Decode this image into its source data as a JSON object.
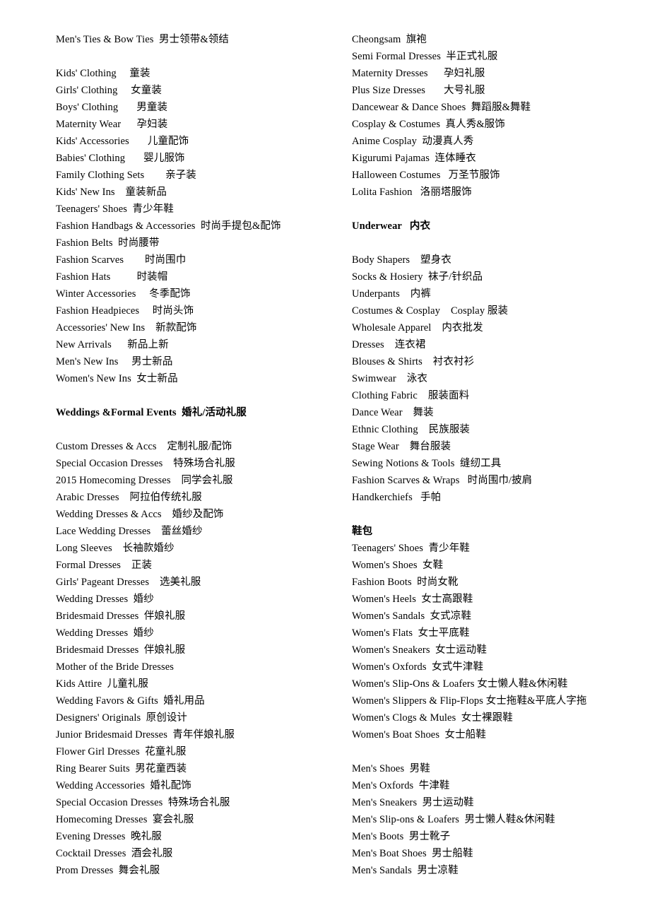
{
  "document": {
    "title": "Clothing & Shoes Category List (English / Chinese)",
    "background_color": "#ffffff",
    "text_color": "#000000",
    "columns": 2
  },
  "left_column": {
    "name": "left-category-column",
    "lines": [
      {
        "type": "entry",
        "text": "Men's Ties & Bow Ties  男士领带&领结"
      },
      {
        "type": "spacer",
        "text": " "
      },
      {
        "type": "entry",
        "text": "Kids' Clothing     童装"
      },
      {
        "type": "entry",
        "text": "Girls' Clothing     女童装"
      },
      {
        "type": "entry",
        "text": "Boys' Clothing       男童装"
      },
      {
        "type": "entry",
        "text": "Maternity Wear      孕妇装"
      },
      {
        "type": "entry",
        "text": "Kids' Accessories       儿童配饰"
      },
      {
        "type": "entry",
        "text": "Babies' Clothing       婴儿服饰"
      },
      {
        "type": "entry",
        "text": "Family Clothing Sets        亲子装"
      },
      {
        "type": "entry",
        "text": "Kids' New Ins    童装新品"
      },
      {
        "type": "entry",
        "text": "Teenagers' Shoes  青少年鞋"
      },
      {
        "type": "entry",
        "text": "Fashion Handbags & Accessories  时尚手提包&配饰"
      },
      {
        "type": "entry",
        "text": "Fashion Belts  时尚腰带"
      },
      {
        "type": "entry",
        "text": "Fashion Scarves        时尚围巾"
      },
      {
        "type": "entry",
        "text": "Fashion Hats          时装帽"
      },
      {
        "type": "entry",
        "text": "Winter Accessories     冬季配饰"
      },
      {
        "type": "entry",
        "text": "Fashion Headpieces     时尚头饰"
      },
      {
        "type": "entry",
        "text": "Accessories' New Ins    新款配饰"
      },
      {
        "type": "entry",
        "text": "New Arrivals      新品上新"
      },
      {
        "type": "entry",
        "text": "Men's New Ins     男士新品"
      },
      {
        "type": "entry",
        "text": "Women's New Ins  女士新品"
      },
      {
        "type": "spacer",
        "text": " "
      },
      {
        "type": "heading",
        "text": "Weddings &Formal Events  婚礼/活动礼服"
      },
      {
        "type": "spacer",
        "text": " "
      },
      {
        "type": "entry",
        "text": "Custom Dresses & Accs    定制礼服/配饰"
      },
      {
        "type": "entry",
        "text": "Special Occasion Dresses    特殊场合礼服"
      },
      {
        "type": "entry",
        "text": "2015 Homecoming Dresses    同学会礼服"
      },
      {
        "type": "entry",
        "text": "Arabic Dresses    阿拉伯传统礼服"
      },
      {
        "type": "entry",
        "text": "Wedding Dresses & Accs    婚纱及配饰"
      },
      {
        "type": "entry",
        "text": "Lace Wedding Dresses    蕾丝婚纱"
      },
      {
        "type": "entry",
        "text": "Long Sleeves    长袖款婚纱"
      },
      {
        "type": "entry",
        "text": "Formal Dresses    正装"
      },
      {
        "type": "entry",
        "text": "Girls' Pageant Dresses    选美礼服"
      },
      {
        "type": "entry",
        "text": "Wedding Dresses  婚纱"
      },
      {
        "type": "entry",
        "text": "Bridesmaid Dresses  伴娘礼服"
      },
      {
        "type": "entry",
        "text": "Wedding Dresses  婚纱"
      },
      {
        "type": "entry",
        "text": "Bridesmaid Dresses  伴娘礼服"
      },
      {
        "type": "entry",
        "text": "Mother of the Bride Dresses"
      },
      {
        "type": "entry",
        "text": "Kids Attire  儿童礼服"
      },
      {
        "type": "entry",
        "text": "Wedding Favors & Gifts  婚礼用品"
      },
      {
        "type": "entry",
        "text": "Designers' Originals  原创设计"
      },
      {
        "type": "entry",
        "text": "Junior Bridesmaid Dresses  青年伴娘礼服"
      },
      {
        "type": "entry",
        "text": "Flower Girl Dresses  花童礼服"
      },
      {
        "type": "entry",
        "text": "Ring Bearer Suits  男花童西装"
      },
      {
        "type": "entry",
        "text": "Wedding Accessories  婚礼配饰"
      },
      {
        "type": "entry",
        "text": "Special Occasion Dresses  特殊场合礼服"
      },
      {
        "type": "entry",
        "text": "Homecoming Dresses  宴会礼服"
      },
      {
        "type": "entry",
        "text": "Evening Dresses  晚礼服"
      },
      {
        "type": "entry",
        "text": "Cocktail Dresses  酒会礼服"
      },
      {
        "type": "entry",
        "text": "Prom Dresses  舞会礼服"
      }
    ]
  },
  "right_column": {
    "name": "right-category-column",
    "lines": [
      {
        "type": "entry",
        "text": "Cheongsam  旗袍"
      },
      {
        "type": "entry",
        "text": "Semi Formal Dresses  半正式礼服"
      },
      {
        "type": "entry",
        "text": "Maternity Dresses      孕妇礼服"
      },
      {
        "type": "entry",
        "text": "Plus Size Dresses       大号礼服"
      },
      {
        "type": "entry",
        "text": "Dancewear & Dance Shoes  舞蹈服&舞鞋"
      },
      {
        "type": "entry",
        "text": "Cosplay & Costumes  真人秀&服饰"
      },
      {
        "type": "entry",
        "text": "Anime Cosplay  动漫真人秀"
      },
      {
        "type": "entry",
        "text": "Kigurumi Pajamas  连体睡衣"
      },
      {
        "type": "entry",
        "text": "Halloween Costumes   万圣节服饰"
      },
      {
        "type": "entry",
        "text": "Lolita Fashion   洛丽塔服饰"
      },
      {
        "type": "spacer",
        "text": " "
      },
      {
        "type": "heading",
        "text": "Underwear   内衣"
      },
      {
        "type": "spacer",
        "text": " "
      },
      {
        "type": "entry",
        "text": "Body Shapers    塑身衣"
      },
      {
        "type": "entry",
        "text": "Socks & Hosiery  袜子/针织品"
      },
      {
        "type": "entry",
        "text": "Underpants    内裤"
      },
      {
        "type": "entry",
        "text": "Costumes & Cosplay    Cosplay 服装"
      },
      {
        "type": "entry",
        "text": "Wholesale Apparel    内衣批发"
      },
      {
        "type": "entry",
        "text": "Dresses    连衣裙"
      },
      {
        "type": "entry",
        "text": "Blouses & Shirts    衬衣衬衫"
      },
      {
        "type": "entry",
        "text": "Swimwear    泳衣"
      },
      {
        "type": "entry",
        "text": "Clothing Fabric    服装面料"
      },
      {
        "type": "entry",
        "text": "Dance Wear    舞装"
      },
      {
        "type": "entry",
        "text": "Ethnic Clothing    民族服装"
      },
      {
        "type": "entry",
        "text": "Stage Wear    舞台服装"
      },
      {
        "type": "entry",
        "text": "Sewing Notions & Tools  缝纫工具"
      },
      {
        "type": "entry",
        "text": "Fashion Scarves & Wraps   时尚围巾/披肩"
      },
      {
        "type": "entry",
        "text": "Handkerchiefs   手帕"
      },
      {
        "type": "spacer",
        "text": " "
      },
      {
        "type": "heading",
        "text": "鞋包"
      },
      {
        "type": "entry",
        "text": "Teenagers' Shoes  青少年鞋"
      },
      {
        "type": "entry",
        "text": "Women's Shoes  女鞋"
      },
      {
        "type": "entry",
        "text": "Fashion Boots  时尚女靴"
      },
      {
        "type": "entry",
        "text": "Women's Heels  女士高跟鞋"
      },
      {
        "type": "entry",
        "text": "Women's Sandals  女式凉鞋"
      },
      {
        "type": "entry",
        "text": "Women's Flats  女士平底鞋"
      },
      {
        "type": "entry",
        "text": "Women's Sneakers  女士运动鞋"
      },
      {
        "type": "entry",
        "text": "Women's Oxfords  女式牛津鞋"
      },
      {
        "type": "entry",
        "text": "Women's Slip-Ons & Loafers 女士懒人鞋&休闲鞋"
      },
      {
        "type": "entry",
        "text": "Women's Slippers & Flip-Flops 女士拖鞋&平底人字拖"
      },
      {
        "type": "entry",
        "text": "Women's Clogs & Mules  女士裸跟鞋"
      },
      {
        "type": "entry",
        "text": "Women's Boat Shoes  女士船鞋"
      },
      {
        "type": "spacer",
        "text": " "
      },
      {
        "type": "entry",
        "text": "Men's Shoes  男鞋"
      },
      {
        "type": "entry",
        "text": "Men's Oxfords  牛津鞋"
      },
      {
        "type": "entry",
        "text": "Men's Sneakers  男士运动鞋"
      },
      {
        "type": "entry",
        "text": "Men's Slip-ons & Loafers  男士懒人鞋&休闲鞋"
      },
      {
        "type": "entry",
        "text": "Men's Boots  男士靴子"
      },
      {
        "type": "entry",
        "text": "Men's Boat Shoes  男士船鞋"
      },
      {
        "type": "entry",
        "text": "Men's Sandals  男士凉鞋"
      }
    ]
  }
}
